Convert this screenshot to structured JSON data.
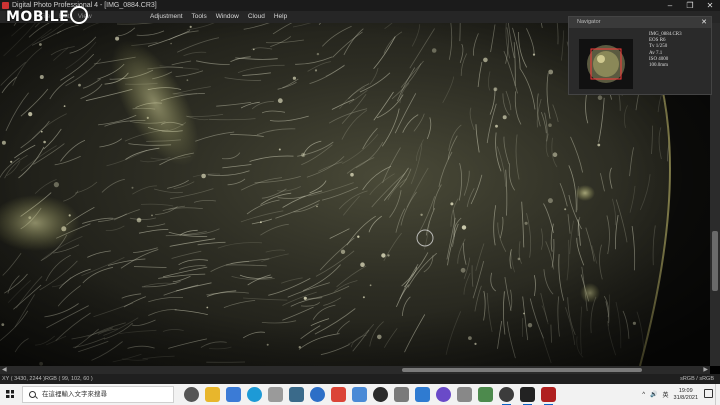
{
  "window": {
    "title": "Digital Photo Professional 4 - [IMG_0884.CR3]",
    "controls": [
      "–",
      "❐",
      "✕"
    ]
  },
  "menu": {
    "items": [
      "File",
      "Edit",
      "View",
      "Adjustment",
      "Tools",
      "Window",
      "Cloud",
      "Help"
    ]
  },
  "watermark": "MOBILE",
  "navigator": {
    "title": "Navigator",
    "close": "✕",
    "info": [
      "IMG_0884.CR3",
      "EOS R6",
      "Tv 1/250",
      "Av 7.1",
      "ISO 4000",
      "100.0mm"
    ]
  },
  "status": {
    "left": "XY ( 3430, 2244 )RGB (  99, 102,  60 )",
    "right": "sRGB / sRGB"
  },
  "scroll": {
    "left_arrow": "◀",
    "right_arrow": "▶"
  },
  "taskbar": {
    "search_placeholder": "在這裡輸入文字來搜尋",
    "apps": [
      {
        "name": "task-view-icon",
        "color": "#555555"
      },
      {
        "name": "file-explorer-icon",
        "color": "#e8b62c"
      },
      {
        "name": "store-icon",
        "color": "#3b7bd6"
      },
      {
        "name": "edge-icon",
        "color": "#1d9ad6"
      },
      {
        "name": "photos-icon",
        "color": "#9a9a9a"
      },
      {
        "name": "camera-app-icon",
        "color": "#3a6a8a"
      },
      {
        "name": "mail-icon",
        "color": "#2d6fc7"
      },
      {
        "name": "chrome-icon",
        "color": "#db4437"
      },
      {
        "name": "brush-icon",
        "color": "#4a8ad6"
      },
      {
        "name": "terminal-icon",
        "color": "#2b2b2b"
      },
      {
        "name": "script-icon",
        "color": "#7a7a7a"
      },
      {
        "name": "image-viewer-icon",
        "color": "#2f7bd1"
      },
      {
        "name": "media-icon",
        "color": "#6a4ac8"
      },
      {
        "name": "disk-icon",
        "color": "#888888"
      },
      {
        "name": "monitor-icon",
        "color": "#4d8a4d"
      },
      {
        "name": "network-icon",
        "color": "#3c3c3c"
      },
      {
        "name": "dpp-icon",
        "color": "#222222"
      },
      {
        "name": "eos-utility-icon",
        "color": "#b02020"
      }
    ],
    "tray": {
      "chevron": "^",
      "lang": "英",
      "time": "19:09",
      "date": "31/8/2021"
    }
  }
}
